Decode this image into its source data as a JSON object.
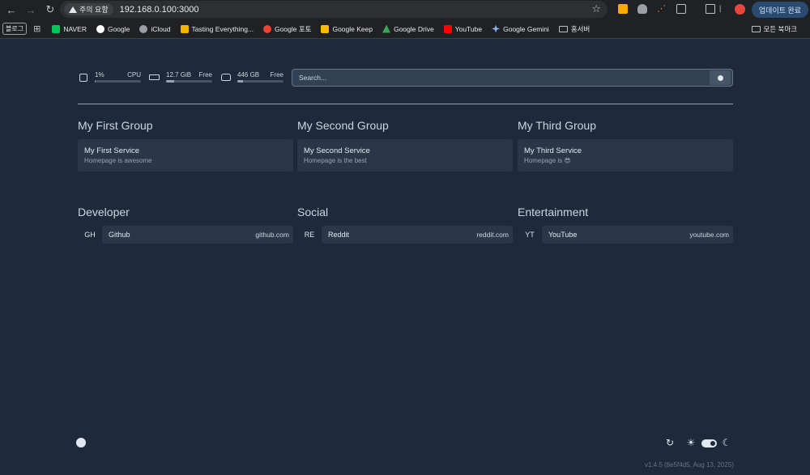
{
  "browser": {
    "security_chip": "주의 요함",
    "url": "192.168.0.100:3000",
    "update_button": "업데이트 완료",
    "bookmarks": [
      {
        "label": "블로그",
        "type": "chip"
      },
      {
        "label": "NAVER",
        "icon_color": "#03c75a"
      },
      {
        "label": "Google",
        "icon_color": "#ffffff"
      },
      {
        "label": "iCloud",
        "icon_color": "#9aa0a6"
      },
      {
        "label": "Tasting Everything...",
        "icon_color": "#f4b400"
      },
      {
        "label": "Google 포토",
        "icon_color": "#ea4335"
      },
      {
        "label": "Google Keep",
        "icon_color": "#fbbc04"
      },
      {
        "label": "Google Drive",
        "icon_color": "#34a853"
      },
      {
        "label": "YouTube",
        "icon_color": "#ff0000"
      },
      {
        "label": "Google Gemini",
        "icon_color": "#8ab4f8"
      },
      {
        "label": "홈서버",
        "icon": "folder-icon"
      }
    ],
    "all_bookmarks": "모든 북마크"
  },
  "widgets": {
    "cpu": {
      "value": "1%",
      "label": "CPU",
      "usage": 0.01
    },
    "memory": {
      "value": "12.7 GiB",
      "label": "Free",
      "usage": 0.18
    },
    "disk": {
      "value": "446 GB",
      "label": "Free",
      "usage": 0.12
    }
  },
  "search": {
    "placeholder": "Search..."
  },
  "groups": [
    {
      "title": "My First Group",
      "service": {
        "name": "My First Service",
        "description": "Homepage is awesome"
      }
    },
    {
      "title": "My Second Group",
      "service": {
        "name": "My Second Service",
        "description": "Homepage is the best"
      }
    },
    {
      "title": "My Third Group",
      "service": {
        "name": "My Third Service",
        "description": "Homepage is 😎"
      }
    }
  ],
  "bookmark_groups": [
    {
      "title": "Developer",
      "abbr": "GH",
      "name": "Github",
      "url": "github.com"
    },
    {
      "title": "Social",
      "abbr": "RE",
      "name": "Reddit",
      "url": "reddit.com"
    },
    {
      "title": "Entertainment",
      "abbr": "YT",
      "name": "YouTube",
      "url": "youtube.com"
    }
  ],
  "footer": {
    "version": "v1.4.5 (8e5f4d5, Aug 13, 2025)"
  },
  "colors": {
    "background": "#1e293b",
    "card": "#2a3749",
    "text": "#cbd5e1"
  }
}
